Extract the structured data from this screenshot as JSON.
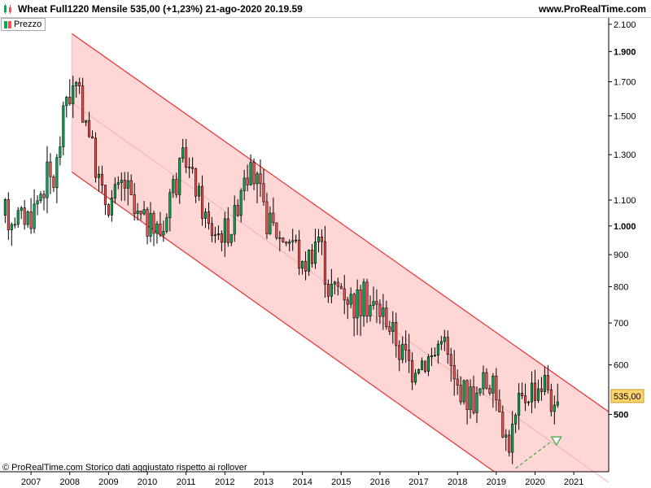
{
  "header": {
    "title": "Wheat Full1220 Mensile 535,00 (+1,23%) 21-ago-2020 20.19.59",
    "site": "www.ProRealTime.com",
    "icon": "candlestick-chart-icon"
  },
  "legend": {
    "label": "Prezzo"
  },
  "footer": {
    "note": "© ProRealTime.com  Storico dati aggiustato rispetto ai rollover"
  },
  "colors": {
    "up_candle": "#00b050",
    "down_candle": "#ff5050",
    "channel_fill": "#ffd6d6",
    "channel_line": "#e83030",
    "price_tag": "#ffd36b",
    "arrow": "#3caa3c"
  },
  "chart_data": {
    "type": "candlestick",
    "instrument": "Wheat Full1220",
    "timeframe": "Mensile",
    "last_price": 535,
    "last_price_label": "535,00",
    "y_scale": "log",
    "ylim": [
      405,
      2150
    ],
    "xlim": [
      2006.2,
      2021.9
    ],
    "y_ticks": [
      {
        "value": 2100,
        "label": "2.100",
        "bold": false
      },
      {
        "value": 1900,
        "label": "1.900",
        "bold": true
      },
      {
        "value": 1700,
        "label": "1.700",
        "bold": false
      },
      {
        "value": 1500,
        "label": "1.500",
        "bold": false
      },
      {
        "value": 1300,
        "label": "1.300",
        "bold": false
      },
      {
        "value": 1100,
        "label": "1.100",
        "bold": false
      },
      {
        "value": 1000,
        "label": "1.000",
        "bold": true
      },
      {
        "value": 900,
        "label": "900",
        "bold": false
      },
      {
        "value": 800,
        "label": "800",
        "bold": false
      },
      {
        "value": 700,
        "label": "700",
        "bold": false
      },
      {
        "value": 600,
        "label": "600",
        "bold": false
      },
      {
        "value": 500,
        "label": "500",
        "bold": true
      }
    ],
    "x_ticks": [
      "2007",
      "2008",
      "2009",
      "2010",
      "2011",
      "2012",
      "2013",
      "2014",
      "2015",
      "2016",
      "2017",
      "2018",
      "2019",
      "2020",
      "2021"
    ],
    "channel": {
      "upper": [
        {
          "x": 2008.05,
          "y": 2030
        },
        {
          "x": 2021.9,
          "y": 505
        }
      ],
      "lower": [
        {
          "x": 2008.05,
          "y": 1220
        },
        {
          "x": 2018.95,
          "y": 405
        }
      ],
      "start_x": 2008.05,
      "end_x": 2021.9
    },
    "annotations": [
      {
        "type": "dashed-arrow",
        "from": {
          "x": 2019.5,
          "y": 410
        },
        "to": {
          "x": 2020.55,
          "y": 455
        }
      }
    ],
    "anchors": [
      [
        2006.25,
        1040
      ],
      [
        2007.0,
        1040
      ],
      [
        2007.4,
        1200
      ],
      [
        2007.6,
        1170
      ],
      [
        2007.9,
        1620
      ],
      [
        2008.2,
        1660
      ],
      [
        2008.5,
        1420
      ],
      [
        2008.8,
        1130
      ],
      [
        2009.0,
        1080
      ],
      [
        2009.4,
        1180
      ],
      [
        2009.7,
        1030
      ],
      [
        2010.0,
        1010
      ],
      [
        2010.4,
        980
      ],
      [
        2010.6,
        1150
      ],
      [
        2011.0,
        1280
      ],
      [
        2011.3,
        1120
      ],
      [
        2011.6,
        990
      ],
      [
        2011.9,
        970
      ],
      [
        2012.2,
        1000
      ],
      [
        2012.5,
        1240
      ],
      [
        2012.8,
        1180
      ],
      [
        2013.0,
        1050
      ],
      [
        2013.4,
        960
      ],
      [
        2013.8,
        950
      ],
      [
        2014.0,
        850
      ],
      [
        2014.4,
        980
      ],
      [
        2014.7,
        790
      ],
      [
        2015.0,
        800
      ],
      [
        2015.3,
        760
      ],
      [
        2015.6,
        760
      ],
      [
        2015.9,
        740
      ],
      [
        2016.2,
        710
      ],
      [
        2016.5,
        640
      ],
      [
        2016.8,
        600
      ],
      [
        2017.0,
        610
      ],
      [
        2017.4,
        620
      ],
      [
        2017.6,
        680
      ],
      [
        2017.9,
        560
      ],
      [
        2018.2,
        540
      ],
      [
        2018.5,
        530
      ],
      [
        2018.7,
        570
      ],
      [
        2018.9,
        550
      ],
      [
        2019.1,
        520
      ],
      [
        2019.3,
        440
      ],
      [
        2019.6,
        520
      ],
      [
        2019.9,
        550
      ],
      [
        2020.1,
        560
      ],
      [
        2020.3,
        570
      ],
      [
        2020.55,
        480
      ],
      [
        2020.63,
        535
      ]
    ]
  }
}
